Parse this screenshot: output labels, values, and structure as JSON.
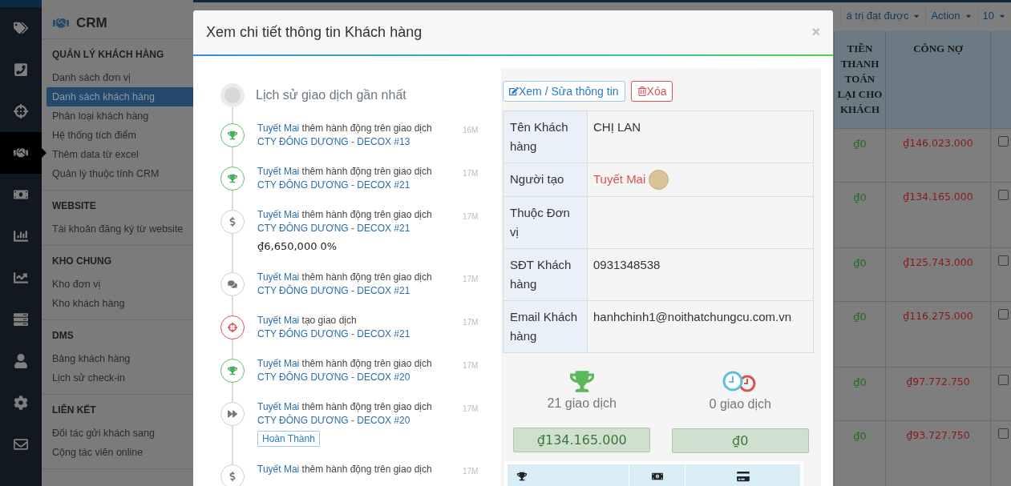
{
  "rail": [
    {
      "kind": "tags",
      "selected": false
    },
    {
      "kind": "phone",
      "selected": false
    },
    {
      "kind": "crosshairs",
      "selected": false
    },
    {
      "kind": "handshake",
      "selected": true
    },
    {
      "kind": "money",
      "selected": false
    },
    {
      "kind": "bar-chart",
      "selected": false
    },
    {
      "kind": "line-chart",
      "selected": false
    },
    {
      "kind": "list",
      "selected": false
    },
    {
      "kind": "user",
      "selected": false
    },
    {
      "kind": "settings",
      "selected": false
    },
    {
      "kind": "mail",
      "selected": false
    }
  ],
  "sidebar": {
    "title": "CRM",
    "sections": [
      {
        "heading": "QUẢN LÝ KHÁCH HÀNG",
        "items": [
          {
            "label": "Danh sách đơn vị",
            "selected": false
          },
          {
            "label": "Danh sách khách hàng",
            "selected": true
          },
          {
            "label": "Phân loại khách hàng",
            "selected": false
          },
          {
            "label": "Hệ thống tích điểm",
            "selected": false
          },
          {
            "label": "Thêm data từ excel",
            "selected": false
          },
          {
            "label": "Quản lý thuộc tính CRM",
            "selected": false
          }
        ]
      },
      {
        "heading": "WEBSITE",
        "items": [
          {
            "label": "Tài khoản đăng ký từ website",
            "selected": false
          }
        ]
      },
      {
        "heading": "KHO CHUNG",
        "items": [
          {
            "label": "Kho đơn vị",
            "selected": false
          },
          {
            "label": "Kho khách hàng",
            "selected": false
          }
        ]
      },
      {
        "heading": "DMS",
        "items": [
          {
            "label": "Bảng khách hàng",
            "selected": false
          },
          {
            "label": "Lịch sử check-in",
            "selected": false
          }
        ]
      },
      {
        "heading": "LIÊN KẾT",
        "items": [
          {
            "label": "Đối tác gửi khách sang",
            "selected": false
          },
          {
            "label": "Cộng tác viên online",
            "selected": false
          }
        ]
      }
    ]
  },
  "toolbar": {
    "buttons": [
      "á trị đạt được",
      "Action",
      "10"
    ]
  },
  "table": {
    "columns": [
      "TIỀN THANH TOÁN LẠI CHO KHÁCH",
      "CÔNG NỢ"
    ],
    "rows": [
      {
        "refund": "₫0",
        "debt": "₫146.023.000",
        "checked": false
      },
      {
        "refund": "₫0",
        "debt": "₫134.165.000",
        "checked": false
      },
      {
        "refund": "₫0",
        "debt": "₫125.743.000",
        "checked": false
      },
      {
        "refund": "₫0",
        "debt": "₫116.275.000",
        "checked": false
      },
      {
        "refund": "₫0",
        "debt": "₫97.772.750",
        "checked": false
      },
      {
        "refund": "₫0",
        "debt": "₫93.727.750",
        "checked": false
      }
    ]
  },
  "modal": {
    "title": "Xem chi tiết thông tin Khách hàng",
    "close": "×",
    "timeline": {
      "heading": "Lịch sử giao dịch gần nhất",
      "items": [
        {
          "kind": "trophy",
          "user": "Tuyết Mai",
          "action": "thêm hành động trên giao dịch",
          "link": "CTY ĐÔNG DƯƠNG - DECOX #13",
          "time": "16M"
        },
        {
          "kind": "trophy",
          "user": "Tuyết Mai",
          "action": "thêm hành động trên giao dịch",
          "link": "CTY ĐÔNG DƯƠNG - DECOX #21",
          "time": "17M"
        },
        {
          "kind": "dollar",
          "user": "Tuyết Mai",
          "action": "thêm hành động trên giao dịch",
          "link": "CTY ĐÔNG DƯƠNG - DECOX #21",
          "time": "17M",
          "amount": "₫6,650,000 0%"
        },
        {
          "kind": "comments",
          "user": "Tuyết Mai",
          "action": "thêm hành động trên giao dịch",
          "link": "CTY ĐÔNG DƯƠNG - DECOX #21",
          "time": "17M"
        },
        {
          "kind": "crosshairs",
          "user": "Tuyết Mai",
          "action": "tạo giao dịch",
          "link": "CTY ĐÔNG DƯƠNG - DECOX #21",
          "time": "17M"
        },
        {
          "kind": "trophy",
          "user": "Tuyết Mai",
          "action": "thêm hành động trên giao dịch",
          "link": "CTY ĐÔNG DƯƠNG - DECOX #20",
          "time": "17M"
        },
        {
          "kind": "forward",
          "user": "Tuyết Mai",
          "action": "thêm hành động trên giao dịch",
          "link": "CTY ĐÔNG DƯƠNG - DECOX #20",
          "time": "17M",
          "badge": "Hoàn Thành"
        },
        {
          "kind": "dollar",
          "user": "Tuyết Mai",
          "action": "thêm hành động trên giao dịch",
          "time": "17M"
        }
      ]
    },
    "customer": {
      "buttons": [
        {
          "kind": "edit",
          "label": "Xem / Sửa thông tin"
        },
        {
          "kind": "delete",
          "label": "Xóa"
        }
      ],
      "fields": [
        {
          "label": "Tên Khách hàng",
          "value": "CHỊ LAN"
        },
        {
          "label": "Người tạo",
          "value": "Tuyết Mai",
          "kind": "user"
        },
        {
          "label": "Thuộc Đơn vị"
        },
        {
          "label": "SĐT Khách hàng",
          "value": "0931348538"
        },
        {
          "label": "Email Khách hàng",
          "value": "hanhchinh1@noithatchungcu.com.vn"
        }
      ],
      "stats": [
        {
          "kind": "trophy",
          "label": "21 giao dịch",
          "amount": "₫134.165.000"
        },
        {
          "kind": "clocks",
          "label": "0 giao dịch",
          "amount": "₫0"
        }
      ]
    }
  }
}
